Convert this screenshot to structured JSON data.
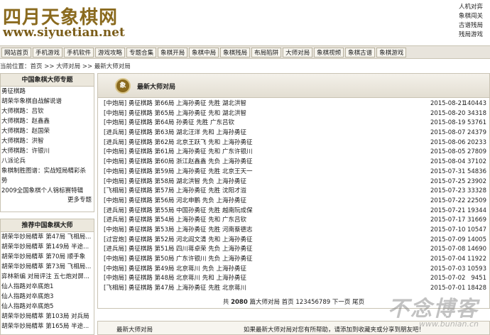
{
  "header": {
    "logo_cn": "四月天象棋网",
    "logo_url": "www.siyuetian.net",
    "top_links": [
      "人机对弈",
      "象棋闯关",
      "古谱残局",
      "残局游戏"
    ]
  },
  "nav": [
    "网站首页",
    "手机游戏",
    "手机软件",
    "游戏攻略",
    "专题合集",
    "象棋开局",
    "象棋中局",
    "象棋残局",
    "布局陷阱",
    "大师对局",
    "象棋视频",
    "象棋古谱",
    "象棋游戏"
  ],
  "breadcrumb": "当前位置：首页 >> 大师对局 >> 最新大师对局",
  "sidebar1": {
    "title": "中国象棋大师专题",
    "items": [
      "勇征棋路",
      "胡荣华象棋自战解说谱",
      "大师棋路：吕钦",
      "大师棋路：赵鑫鑫",
      "大师棋路：赵国荣",
      "大师棋路：洪智",
      "大师棋路：许银川",
      "八派论兵",
      "象棋制胜图谱：实战短局精彩杀",
      "势",
      "2009全国象棋个人锦标赛特辑"
    ],
    "more": "更多专题"
  },
  "sidebar2": {
    "title": "推荐中国象棋大师",
    "items": [
      "胡荣华妙局精萃 第47局 飞相局...",
      "胡荣华妙局精萃 第149局 半途...",
      "胡荣华妙局精萃 第70局 顺手象",
      "胡荣华妙局精萃 第73局 飞相局...",
      "弈林新编 对局评注 五七炮对屏...",
      "仙人指路对卒底炮1",
      "仙人指路对卒底炮3",
      "仙人指路对卒底炮5",
      "胡荣华妙局精萃 第103局 对兵局",
      "胡荣华妙局精萃 第165局 半途..."
    ]
  },
  "main": {
    "icon": "象",
    "title": "最新大师对局",
    "rows": [
      {
        "title": "[中炮局] 勇征棋路 第66局 上海孙勇征 先胜 湖北洪智",
        "date": "2015-08-21",
        "views": "140443"
      },
      {
        "title": "[中炮局] 勇征棋路 第65局 上海孙勇征 先和 湖北洪智",
        "date": "2015-08-20",
        "views": "34318"
      },
      {
        "title": "[中炮局] 勇征棋路 第64局 孙勇征 先胜 广东吕钦",
        "date": "2015-08-19",
        "views": "53761"
      },
      {
        "title": "[进兵局] 勇征棋路 第63局 湖北汪洋 先和 上海孙勇征",
        "date": "2015-08-07",
        "views": "24379"
      },
      {
        "title": "[进兵局] 勇征棋路 第62局 北京王跃飞 先和 上海孙勇征",
        "date": "2015-08-06",
        "views": "20233"
      },
      {
        "title": "[中炮局] 勇征棋路 第61局 上海孙勇征 先和 广东许银川",
        "date": "2015-08-05",
        "views": "27809"
      },
      {
        "title": "[中炮局] 勇征棋路 第60局 浙江赵鑫鑫 先负 上海孙勇征",
        "date": "2015-08-04",
        "views": "37102"
      },
      {
        "title": "[中炮局] 勇征棋路 第59局 上海孙勇征 先胜 北京王天一",
        "date": "2015-07-31",
        "views": "54836"
      },
      {
        "title": "[中炮局] 勇征棋路 第58局 湖北洪智 先负 上海孙勇征",
        "date": "2015-07-25",
        "views": "23902"
      },
      {
        "title": "[飞相局] 勇征棋路 第57局 上海孙勇征 先胜 沈阳才溢",
        "date": "2015-07-23",
        "views": "33328"
      },
      {
        "title": "[中炮局] 勇征棋路 第56局 河北申鹏 先负 上海孙勇征",
        "date": "2015-07-22",
        "views": "22509"
      },
      {
        "title": "[进兵局] 勇征棋路 第55局 中国孙勇征 先胜 越南阮成保",
        "date": "2015-07-21",
        "views": "19344"
      },
      {
        "title": "[进兵局] 勇征棋路 第54局 上海孙勇征 先和 广东吕钦",
        "date": "2015-07-17",
        "views": "31669"
      },
      {
        "title": "[中炮局] 勇征棋路 第53局 上海孙勇征 先胜 河南蔡德志",
        "date": "2015-07-10",
        "views": "10547"
      },
      {
        "title": "[过宫炮] 勇征棋路 第52局 河北阎文清 先和 上海孙勇征",
        "date": "2015-07-09",
        "views": "14005"
      },
      {
        "title": "[进兵局] 勇征棋路 第51局 四川蒋卓荣 先负 上海孙勇征",
        "date": "2015-07-08",
        "views": "14690"
      },
      {
        "title": "[中炮局] 勇征棋路 第50局 广东许银川 先负 上海孙勇征",
        "date": "2015-07-04",
        "views": "11922"
      },
      {
        "title": "[中炮局] 勇征棋路 第49局 北京蒋川 先负 上海孙勇征",
        "date": "2015-07-03",
        "views": "10593"
      },
      {
        "title": "[中炮局] 勇征棋路 第48局 北京蒋川 先和 上海孙勇征",
        "date": "2015-07-02",
        "views": "9451"
      },
      {
        "title": "[飞相局] 勇征棋路 第47局 上海孙勇征 先胜 北京蒋川",
        "date": "2015-07-01",
        "views": "18428"
      }
    ],
    "pager": {
      "prefix": "共",
      "total": "2080",
      "suffix": "篇大师对局 首页",
      "pages": [
        "1",
        "2",
        "3",
        "4",
        "5",
        "6",
        "7",
        "8",
        "9"
      ],
      "next": "下一页",
      "last": "尾页"
    }
  },
  "bottom": {
    "left": "最新大师对局",
    "right": "如果最新大师对局对您有所帮助，请添加到收藏夹或分享到朋友吧！"
  },
  "watermark": {
    "cn": "不念博客",
    "url": "www.bunian.cn"
  }
}
